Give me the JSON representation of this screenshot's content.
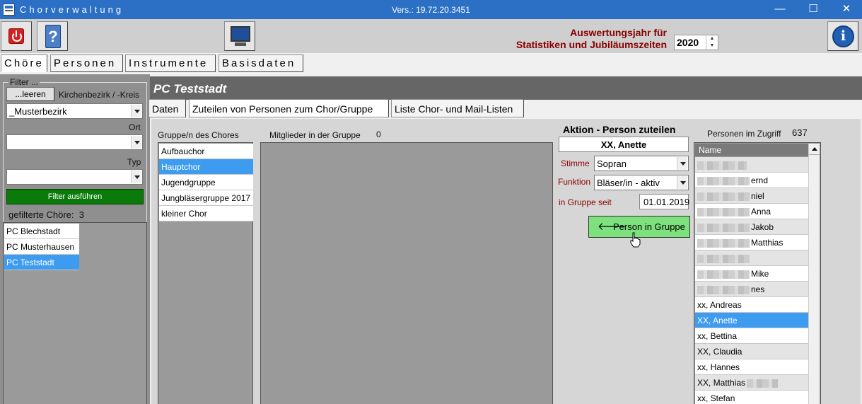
{
  "window": {
    "title": "Chorverwaltung",
    "version": "Vers.: 19.72.20.3451",
    "minimize": "—",
    "maximize": "☐",
    "close": "✕"
  },
  "toolbar": {
    "stat_label_line1": "Auswertungsjahr für",
    "stat_label_line2": "Statistiken und Jubiläumszeiten",
    "year": "2020",
    "help_glyph": "?",
    "info_glyph": "i"
  },
  "main_tabs": [
    {
      "label": "Chöre",
      "active": true
    },
    {
      "label": "Personen",
      "active": false
    },
    {
      "label": "Instrumente",
      "active": false
    },
    {
      "label": "Basisdaten",
      "active": false
    }
  ],
  "filter": {
    "legend": "Filter ...",
    "clear_button": "...leeren",
    "district_label": "Kirchenbezirk / -Kreis",
    "district_value": "_Musterbezirk",
    "ort_label": "Ort",
    "ort_value": "",
    "typ_label": "Typ",
    "typ_value": "",
    "run_button": "Filter ausführen",
    "count_label": "gefilterte Chöre:",
    "count_value": "3"
  },
  "choirs": [
    {
      "name": "PC Blechstadt",
      "selected": false
    },
    {
      "name": "PC Musterhausen",
      "selected": false
    },
    {
      "name": "PC Teststadt",
      "selected": true
    }
  ],
  "detail": {
    "title": "PC Teststadt",
    "sub_tabs": [
      {
        "label": "Daten",
        "active": false
      },
      {
        "label": "Zuteilen von Personen zum Chor/Gruppe",
        "active": true
      },
      {
        "label": "Liste Chor- und Mail-Listen",
        "active": false
      }
    ],
    "groups_label": "Gruppe/n des Chores",
    "groups": [
      {
        "name": "Aufbauchor",
        "selected": false
      },
      {
        "name": "Hauptchor",
        "selected": true
      },
      {
        "name": "Jugendgruppe",
        "selected": false
      },
      {
        "name": "Jungbläsergruppe 2017",
        "selected": false
      },
      {
        "name": "kleiner Chor",
        "selected": false
      }
    ],
    "members_label": "Mitglieder in der Gruppe",
    "members_count": "0",
    "action": {
      "title": "Aktion - Person zuteilen",
      "person": "XX, Anette",
      "stimme_label": "Stimme",
      "stimme_value": "Sopran",
      "funktion_label": "Funktion",
      "funktion_value": "Bläser/in - aktiv",
      "since_label": "in Gruppe seit",
      "since_value": "01.01.2019",
      "assign_button": "Person in Gruppe",
      "assign_arrow": "🡐"
    },
    "persons_label": "Personen im Zugriff",
    "persons_count": "637",
    "persons_header": "Name",
    "persons": [
      {
        "text": "",
        "blur": 70,
        "selected": false
      },
      {
        "text": "ernd",
        "blur": 74,
        "selected": false
      },
      {
        "text": "niel",
        "blur": 74,
        "selected": false
      },
      {
        "text": "Anna",
        "blur": 74,
        "selected": false
      },
      {
        "text": "Jakob",
        "blur": 74,
        "selected": false
      },
      {
        "text": "Matthias",
        "blur": 74,
        "selected": false
      },
      {
        "text": "",
        "blur": 74,
        "selected": false
      },
      {
        "text": "Mike",
        "blur": 74,
        "selected": false
      },
      {
        "text": "nes",
        "blur": 74,
        "selected": false
      },
      {
        "text": "xx, Andreas",
        "blur": 0,
        "selected": false
      },
      {
        "text": "XX, Anette",
        "blur": 0,
        "selected": true
      },
      {
        "text": "xx, Bettina",
        "blur": 0,
        "selected": false
      },
      {
        "text": "XX, Claudia",
        "blur": 0,
        "selected": false
      },
      {
        "text": "xx, Hannes",
        "blur": 0,
        "selected": false
      },
      {
        "text": "XX, Matthias",
        "blur": 0,
        "trailing_blur": 44,
        "selected": false
      },
      {
        "text": "xx, Stefan",
        "blur": 0,
        "selected": false
      }
    ]
  }
}
